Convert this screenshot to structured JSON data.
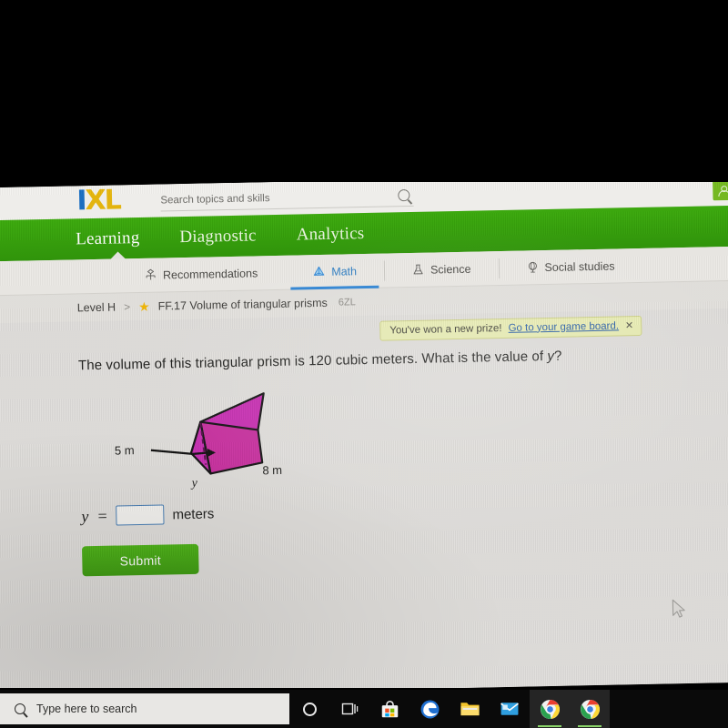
{
  "topbar": {
    "logo_i": "I",
    "logo_xl": "XL",
    "search_placeholder": "Search topics and skills",
    "search_value": "",
    "search_icon": "search-icon",
    "avatar_icon": "user-avatar-icon"
  },
  "greenbar": {
    "items": [
      {
        "label": "Learning",
        "active": true
      },
      {
        "label": "Diagnostic",
        "active": false
      },
      {
        "label": "Analytics",
        "active": false
      }
    ]
  },
  "subjects": [
    {
      "label": "Recommendations",
      "icon": "recommendations-icon",
      "active": false
    },
    {
      "label": "Math",
      "icon": "math-prism-icon",
      "active": true
    },
    {
      "label": "Science",
      "icon": "science-flask-icon",
      "active": false
    },
    {
      "label": "Social studies",
      "icon": "globe-icon",
      "active": false
    }
  ],
  "breadcrumb": {
    "level": "Level H",
    "chevron": ">",
    "star_icon": "star-icon",
    "skill": "FF.17 Volume of triangular prisms",
    "code": "6ZL"
  },
  "prize_banner": {
    "message": "You've won a new prize!",
    "link": "Go to your game board.",
    "close_icon": "close-icon"
  },
  "question": {
    "text_before": "The volume of this triangular prism is 120 cubic meters. What is the value of ",
    "variable": "y",
    "text_after": "?"
  },
  "figure": {
    "label_side": "5 m",
    "label_height": "y",
    "label_length": "8 m",
    "fill_color": "#c72fb2",
    "stroke_color": "#1a1a1a"
  },
  "answer": {
    "variable": "y",
    "equals": "=",
    "value": "",
    "units": "meters"
  },
  "submit": {
    "label": "Submit",
    "color": "#49ab16"
  },
  "taskbar": {
    "search_placeholder": "Type here to search",
    "search_icon": "search-icon",
    "items": [
      {
        "name": "cortana-icon",
        "open": false
      },
      {
        "name": "task-view-icon",
        "open": false
      },
      {
        "name": "microsoft-store-icon",
        "open": false
      },
      {
        "name": "edge-icon",
        "open": false
      },
      {
        "name": "file-explorer-icon",
        "open": false
      },
      {
        "name": "mail-icon",
        "open": false
      },
      {
        "name": "chrome-icon",
        "open": true
      },
      {
        "name": "chrome-icon",
        "open": true
      }
    ]
  }
}
